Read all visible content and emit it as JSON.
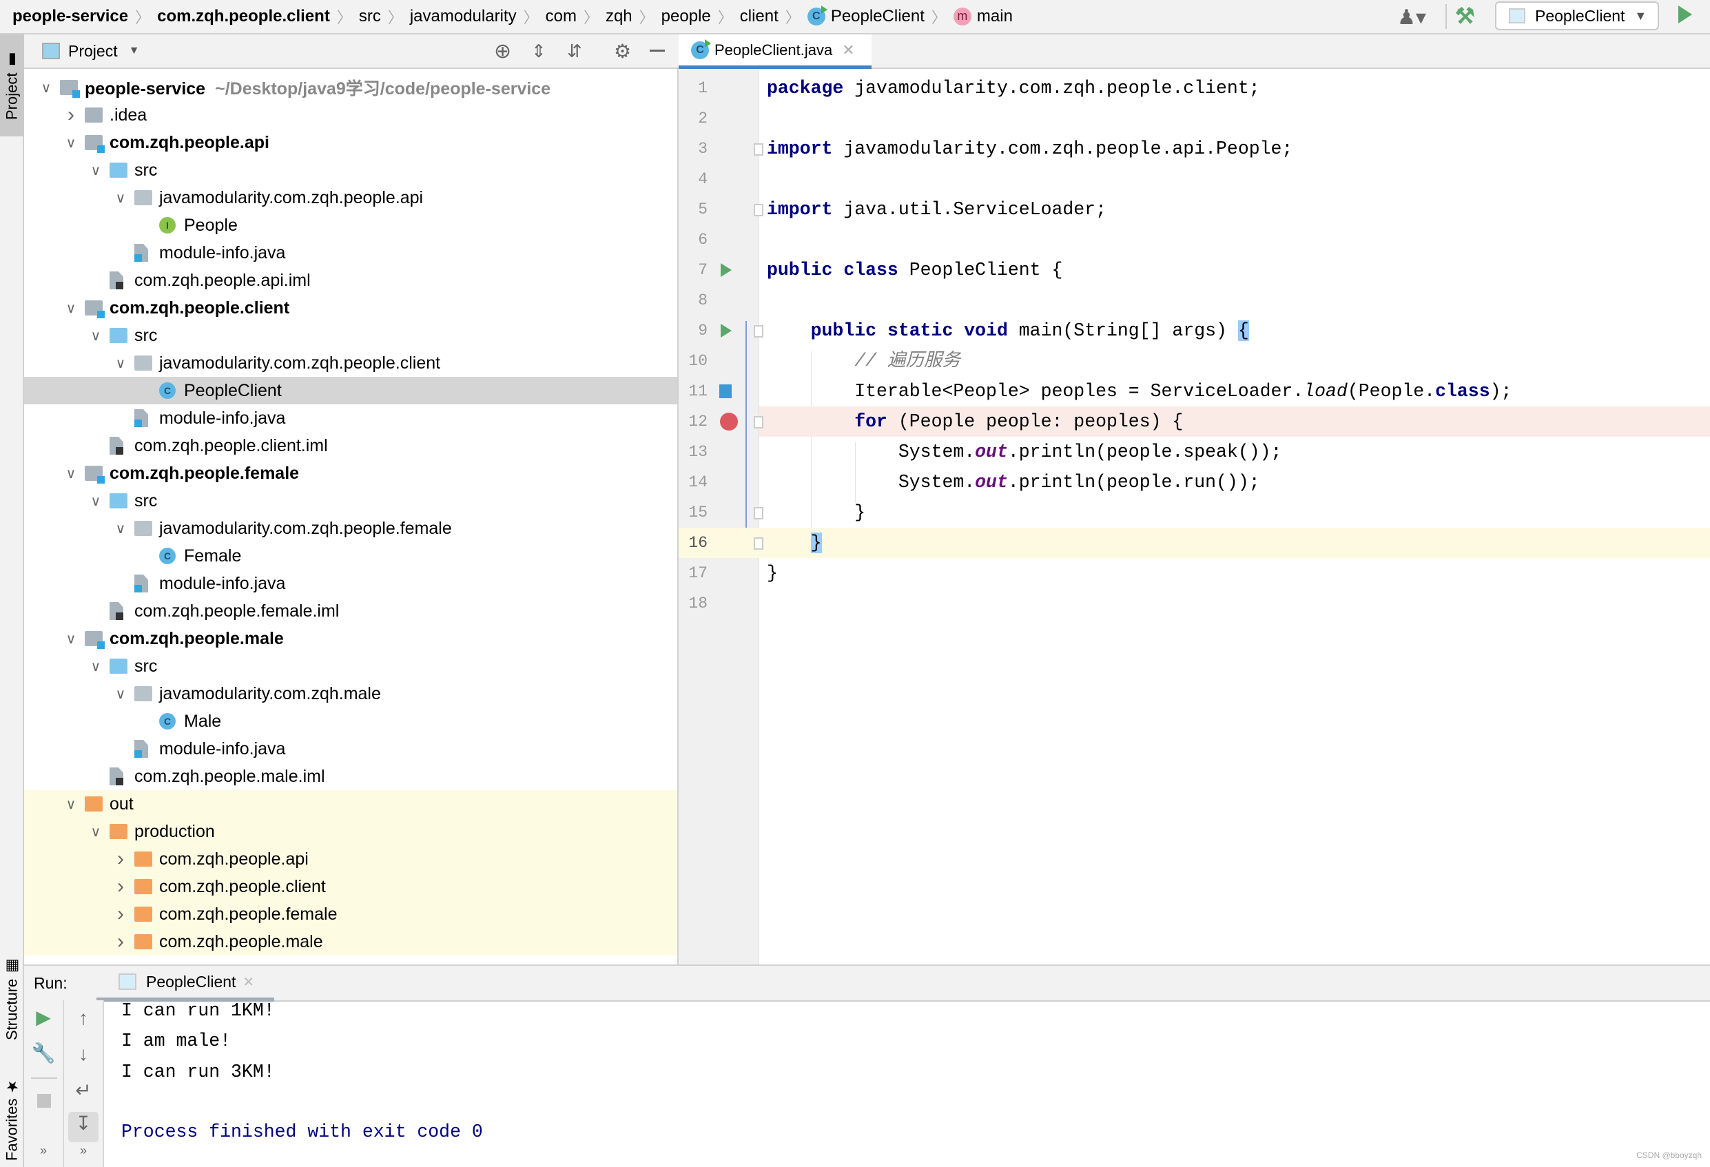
{
  "breadcrumb": [
    {
      "label": "people-service",
      "bold": true
    },
    {
      "label": "com.zqh.people.client",
      "bold": true
    },
    {
      "label": "src"
    },
    {
      "label": "javamodularity"
    },
    {
      "label": "com"
    },
    {
      "label": "zqh"
    },
    {
      "label": "people"
    },
    {
      "label": "client"
    },
    {
      "label": "PeopleClient",
      "icon": "class-icon"
    },
    {
      "label": "main",
      "icon": "method-icon"
    }
  ],
  "toolbar": {
    "run_config": "PeopleClient",
    "icons": [
      "user-icon",
      "hammer-icon",
      "run-icon"
    ]
  },
  "left_strip": {
    "project": "Project",
    "structure": "Structure",
    "favorites": "Favorites"
  },
  "project_panel": {
    "title": "Project"
  },
  "tree": [
    {
      "label": "people-service",
      "hint": "~/Desktop/java9学习/code/people-service",
      "level": 0,
      "icon": "module",
      "expanded": true,
      "bold": true
    },
    {
      "label": ".idea",
      "level": 1,
      "icon": "folder",
      "expanded": false
    },
    {
      "label": "com.zqh.people.api",
      "level": 1,
      "icon": "module",
      "expanded": true,
      "bold": true
    },
    {
      "label": "src",
      "level": 2,
      "icon": "src",
      "expanded": true
    },
    {
      "label": "javamodularity.com.zqh.people.api",
      "level": 3,
      "icon": "pkg",
      "expanded": true
    },
    {
      "label": "People",
      "level": 4,
      "icon": "interface"
    },
    {
      "label": "module-info.java",
      "level": 3,
      "icon": "java"
    },
    {
      "label": "com.zqh.people.api.iml",
      "level": 2,
      "icon": "iml"
    },
    {
      "label": "com.zqh.people.client",
      "level": 1,
      "icon": "module",
      "expanded": true,
      "bold": true
    },
    {
      "label": "src",
      "level": 2,
      "icon": "src",
      "expanded": true
    },
    {
      "label": "javamodularity.com.zqh.people.client",
      "level": 3,
      "icon": "pkg",
      "expanded": true
    },
    {
      "label": "PeopleClient",
      "level": 4,
      "icon": "class",
      "selected": true
    },
    {
      "label": "module-info.java",
      "level": 3,
      "icon": "java"
    },
    {
      "label": "com.zqh.people.client.iml",
      "level": 2,
      "icon": "iml"
    },
    {
      "label": "com.zqh.people.female",
      "level": 1,
      "icon": "module",
      "expanded": true,
      "bold": true
    },
    {
      "label": "src",
      "level": 2,
      "icon": "src",
      "expanded": true
    },
    {
      "label": "javamodularity.com.zqh.people.female",
      "level": 3,
      "icon": "pkg",
      "expanded": true
    },
    {
      "label": "Female",
      "level": 4,
      "icon": "class"
    },
    {
      "label": "module-info.java",
      "level": 3,
      "icon": "java"
    },
    {
      "label": "com.zqh.people.female.iml",
      "level": 2,
      "icon": "iml"
    },
    {
      "label": "com.zqh.people.male",
      "level": 1,
      "icon": "module",
      "expanded": true,
      "bold": true
    },
    {
      "label": "src",
      "level": 2,
      "icon": "src",
      "expanded": true
    },
    {
      "label": "javamodularity.com.zqh.male",
      "level": 3,
      "icon": "pkg",
      "expanded": true
    },
    {
      "label": "Male",
      "level": 4,
      "icon": "class"
    },
    {
      "label": "module-info.java",
      "level": 3,
      "icon": "java"
    },
    {
      "label": "com.zqh.people.male.iml",
      "level": 2,
      "icon": "iml"
    },
    {
      "label": "out",
      "level": 1,
      "icon": "orange",
      "expanded": true,
      "excluded": true
    },
    {
      "label": "production",
      "level": 2,
      "icon": "orange",
      "expanded": true,
      "excluded": true
    },
    {
      "label": "com.zqh.people.api",
      "level": 3,
      "icon": "orange",
      "expanded": false,
      "excluded": true
    },
    {
      "label": "com.zqh.people.client",
      "level": 3,
      "icon": "orange",
      "expanded": false,
      "excluded": true
    },
    {
      "label": "com.zqh.people.female",
      "level": 3,
      "icon": "orange",
      "expanded": false,
      "excluded": true
    },
    {
      "label": "com.zqh.people.male",
      "level": 3,
      "icon": "orange",
      "expanded": false,
      "excluded": true
    }
  ],
  "editor": {
    "tab": "PeopleClient.java",
    "lines": [
      [
        [
          "package",
          "kw"
        ],
        [
          " javamodularity.com.zqh.people.client;",
          ""
        ]
      ],
      [],
      [
        [
          "import",
          "kw"
        ],
        [
          " javamodularity.com.zqh.people.api.People;",
          ""
        ]
      ],
      [],
      [
        [
          "import",
          "kw"
        ],
        [
          " java.util.ServiceLoader;",
          ""
        ]
      ],
      [],
      [
        [
          "public class",
          "kw"
        ],
        [
          " PeopleClient {",
          ""
        ]
      ],
      [],
      [
        [
          "    ",
          ""
        ],
        [
          "public static void",
          "kw"
        ],
        [
          " main(String[] args) ",
          ""
        ],
        [
          "{",
          "br"
        ]
      ],
      [
        [
          "        ",
          ""
        ],
        [
          "// 遍历服务",
          "cm"
        ]
      ],
      [
        [
          "        Iterable<People> peoples = ServiceLoader.",
          ""
        ],
        [
          "load",
          "it"
        ],
        [
          "(People.",
          ""
        ],
        [
          "class",
          "kw"
        ],
        [
          ");",
          ""
        ]
      ],
      [
        [
          "        ",
          ""
        ],
        [
          "for",
          "kw"
        ],
        [
          " (People people: peoples) {",
          ""
        ]
      ],
      [
        [
          "            System.",
          ""
        ],
        [
          "out",
          "st"
        ],
        [
          ".println(people.speak());",
          ""
        ]
      ],
      [
        [
          "            System.",
          ""
        ],
        [
          "out",
          "st"
        ],
        [
          ".println(people.run());",
          ""
        ]
      ],
      [
        [
          "        }",
          ""
        ]
      ],
      [
        [
          "    ",
          ""
        ],
        [
          "}",
          "br"
        ]
      ],
      [
        [
          "}",
          ""
        ]
      ],
      []
    ],
    "run_gutter_lines": [
      7,
      9
    ],
    "breakpoint_line": 12,
    "current_line": 16,
    "colors": {
      "keyword": "#000080",
      "static_field": "#660e7a",
      "breakpoint_bg": "#faebe7",
      "current_line_bg": "#fef9e1"
    }
  },
  "run_panel": {
    "label": "Run:",
    "tab": "PeopleClient",
    "output": [
      "I can run 1KM!",
      "I am male!",
      "I can run 3KM!",
      ""
    ],
    "exit_message": "Process finished with exit code 0"
  },
  "watermark": "CSDN @bboyzqh"
}
